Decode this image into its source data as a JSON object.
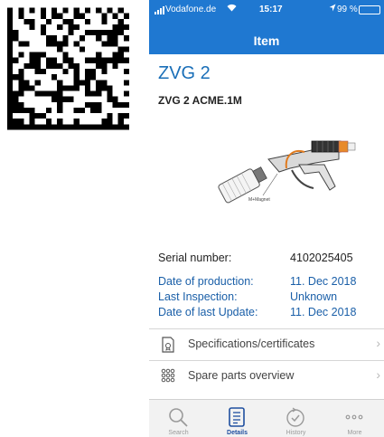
{
  "status_bar": {
    "carrier": "Vodafone.de",
    "time": "15:17",
    "battery": "99 %"
  },
  "nav": {
    "title": "Item"
  },
  "item": {
    "name": "ZVG 2",
    "model": "ZVG 2 ACME.1M"
  },
  "details": {
    "serial_label": "Serial number:",
    "serial_value": "4102025405",
    "production_label": "Date of production:",
    "production_value": "11. Dec 2018",
    "inspection_label": "Last Inspection:",
    "inspection_value": "Unknown",
    "update_label": "Date of last Update:",
    "update_value": "11. Dec 2018"
  },
  "menu": [
    {
      "label": "Specifications/certificates",
      "icon": "certificate-icon"
    },
    {
      "label": "Spare parts overview",
      "icon": "grid-dots-icon"
    }
  ],
  "tabs": [
    {
      "label": "Search",
      "icon": "search-icon"
    },
    {
      "label": "Details",
      "icon": "details-icon"
    },
    {
      "label": "History",
      "icon": "history-icon"
    },
    {
      "label": "More",
      "icon": "more-icon"
    }
  ],
  "active_tab": "Details",
  "colors": {
    "header": "#1f78d1",
    "title_blue": "#1a6fb8",
    "active_tab": "#1f4fa0"
  }
}
